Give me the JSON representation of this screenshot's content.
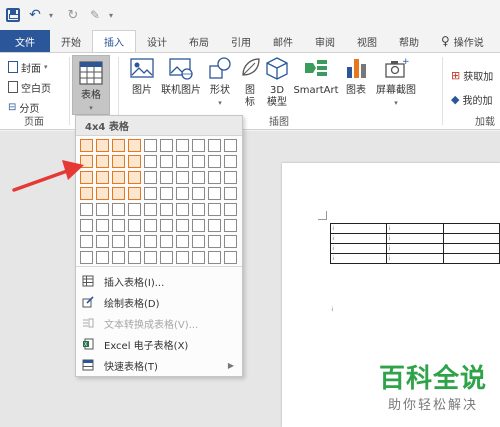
{
  "qat": {
    "quick_access_caret": "▾"
  },
  "tabs": [
    {
      "label": "文件"
    },
    {
      "label": "开始"
    },
    {
      "label": "插入"
    },
    {
      "label": "设计"
    },
    {
      "label": "布局"
    },
    {
      "label": "引用"
    },
    {
      "label": "邮件"
    },
    {
      "label": "审阅"
    },
    {
      "label": "视图"
    },
    {
      "label": "帮助"
    },
    {
      "label": "操作说"
    }
  ],
  "ribbon": {
    "pages_group": {
      "cover": "封面",
      "blank": "空白页",
      "break": "分页",
      "label": "页面"
    },
    "table_button": "表格",
    "illustrations": {
      "picture": "图片",
      "online_picture": "联机图片",
      "shapes": "形状",
      "icons_1": "图",
      "icons_2": "标",
      "model_1": "3D",
      "model_2": "模型",
      "smartart": "SmartArt",
      "chart": "图表",
      "screenshot": "屏幕截图",
      "label": "插图"
    },
    "addins": {
      "get": "获取加",
      "mine": "我的加",
      "label": "加载"
    }
  },
  "dropdown": {
    "header": "4x4 表格",
    "grid_rows": 8,
    "grid_cols": 10,
    "selected_rows": 4,
    "selected_cols": 4,
    "items": [
      {
        "label": "插入表格(I)...",
        "disabled": false
      },
      {
        "label": "绘制表格(D)",
        "disabled": false
      },
      {
        "label": "文本转换成表格(V)...",
        "disabled": true
      },
      {
        "label": "Excel 电子表格(X)",
        "disabled": false
      },
      {
        "label": "快速表格(T)",
        "disabled": false
      }
    ]
  },
  "watermark": {
    "title": "百科全说",
    "subtitle": "助你轻松解决"
  },
  "colors": {
    "accent": "#2b579a",
    "highlight": "#e8781e",
    "arrow": "#e53935",
    "watermark": "#2fa34a"
  }
}
